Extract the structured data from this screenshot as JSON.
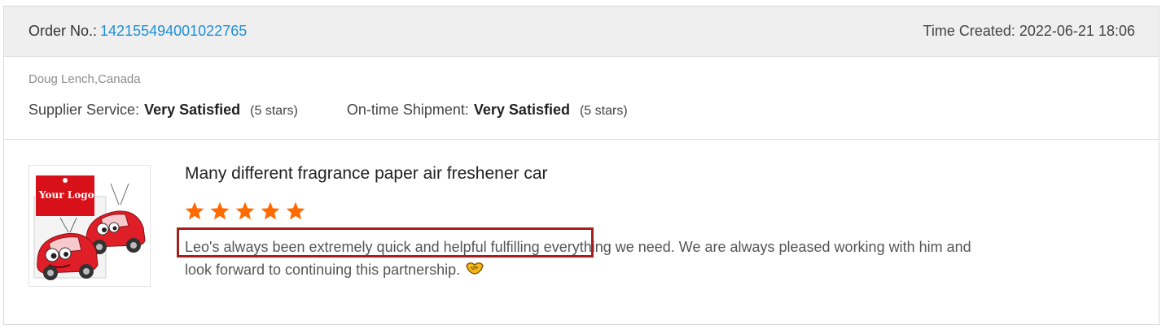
{
  "header": {
    "order_label": "Order No.:",
    "order_number": "142155494001022765",
    "time_created": "Time Created: 2022-06-21 18:06"
  },
  "buyer": {
    "name": "Doug Lench,Canada"
  },
  "ratings": {
    "supplier_service": {
      "label": "Supplier Service:",
      "value": "Very Satisfied",
      "stars": "(5 stars)"
    },
    "on_time_shipment": {
      "label": "On-time Shipment:",
      "value": "Very Satisfied",
      "stars": "(5 stars)"
    }
  },
  "product": {
    "title": "Many different fragrance paper air freshener car",
    "image_logo_text": "Your Logo",
    "rating": 5,
    "review_text": "Leo's always been extremely quick and helpful fulfilling everything we need. We are always pleased working with him and look forward to continuing this partnership."
  },
  "colors": {
    "accent": "#1f8fd6",
    "star": "#ff6a00",
    "highlight": "#a51f1f"
  },
  "icons": {
    "stars": "star-icon",
    "emoji": "handshake-emoji-icon"
  }
}
